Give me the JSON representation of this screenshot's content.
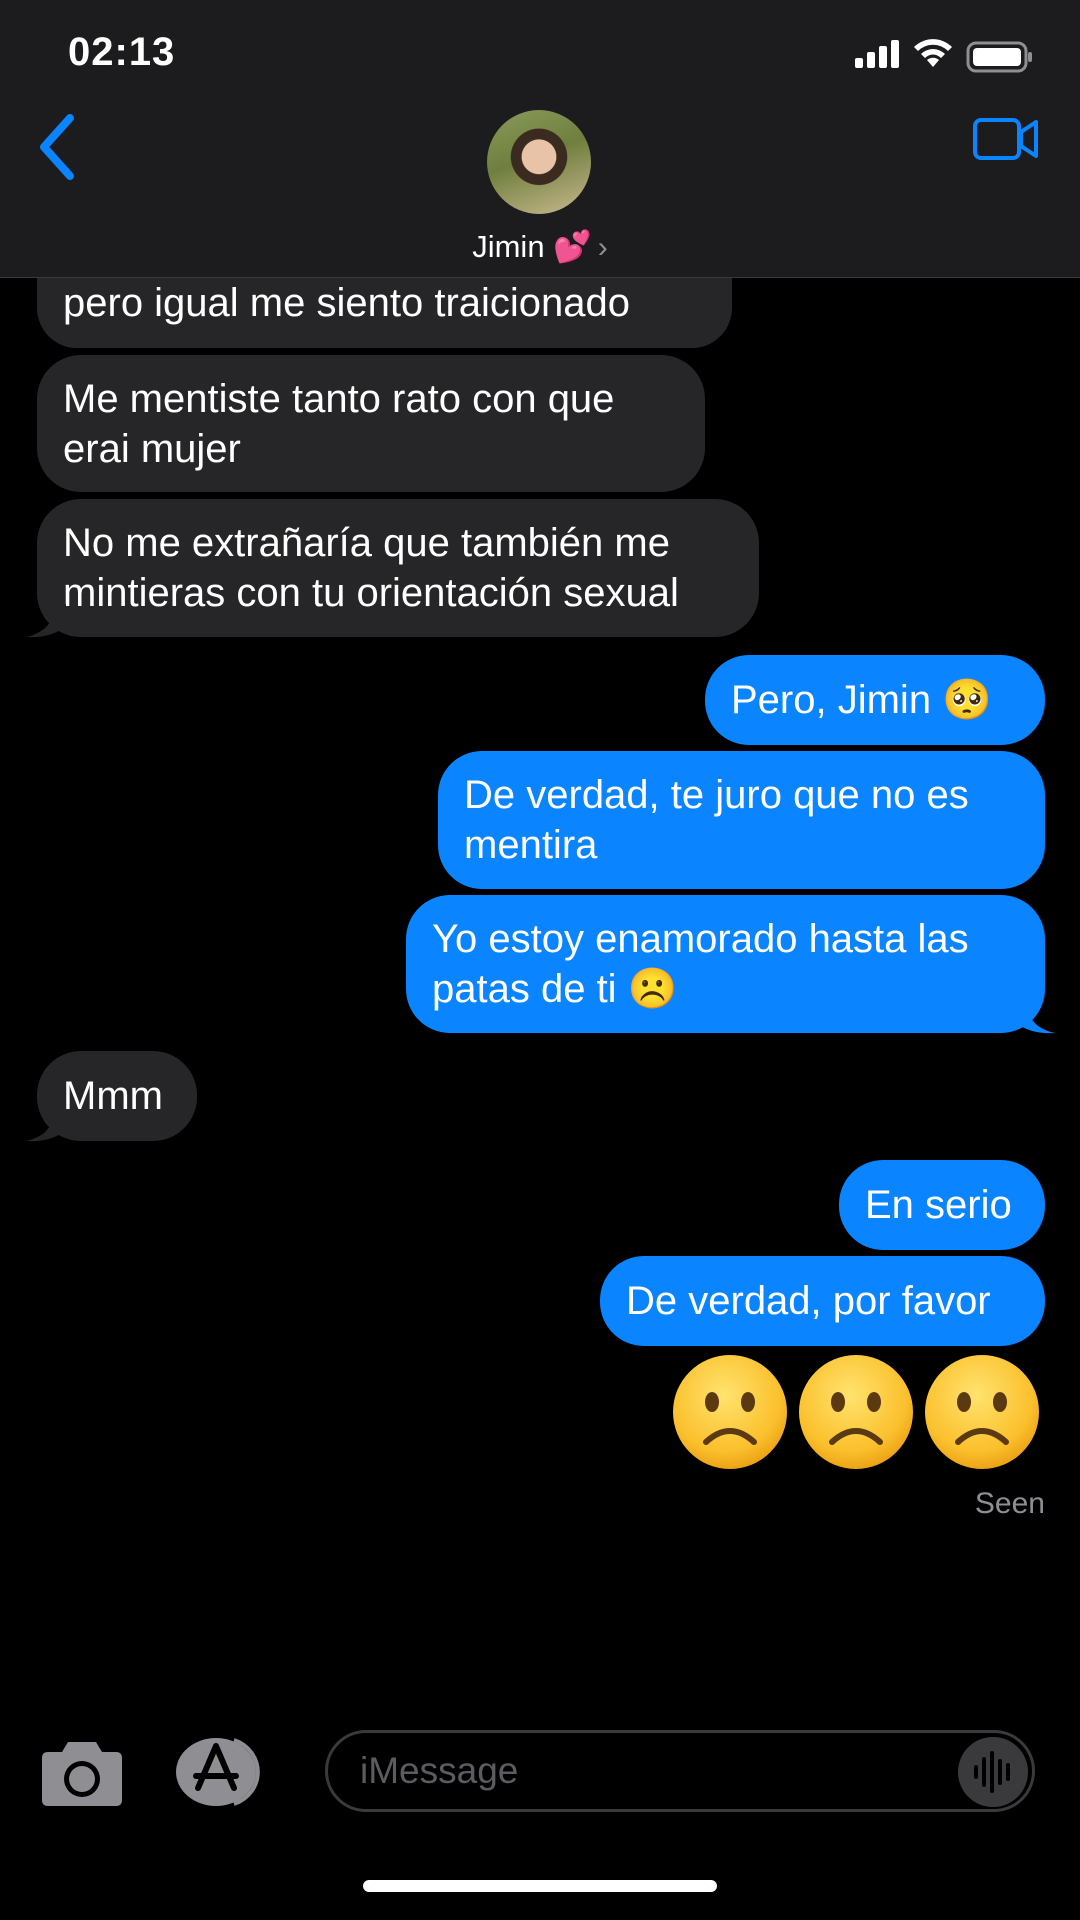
{
  "status_bar": {
    "time": "02:13"
  },
  "header": {
    "contact_name": "Jimin 💕",
    "chevron": "›"
  },
  "icons": {
    "back": "chevron-left-icon",
    "video": "video-camera-icon",
    "camera": "camera-icon",
    "appstore": "app-store-icon",
    "audio": "audio-waveform-icon"
  },
  "colors": {
    "accent": "#0a84ff",
    "received_bubble": "#262628",
    "header_bg": "#1c1c1e",
    "background": "#000000"
  },
  "messages": [
    {
      "direction": "received",
      "text": "pero igual me siento traicionado"
    },
    {
      "direction": "received",
      "text": "Me mentiste tanto rato con que erai mujer"
    },
    {
      "direction": "received",
      "text": "No me extrañaría que también me mintieras con tu orientación sexual"
    },
    {
      "direction": "sent",
      "text": "Pero, Jimin 🥺"
    },
    {
      "direction": "sent",
      "text": "De verdad, te juro que no es mentira"
    },
    {
      "direction": "sent",
      "text": "Yo estoy enamorado hasta las patas de ti ☹️"
    },
    {
      "direction": "received",
      "text": "Mmm"
    },
    {
      "direction": "sent",
      "text": "En serio"
    },
    {
      "direction": "sent",
      "text": "De verdad, por favor"
    },
    {
      "direction": "sent",
      "text": "☹️☹️☹️",
      "jumbo_emoji_count": 3
    }
  ],
  "read_receipt": "Seen",
  "input": {
    "placeholder": "iMessage",
    "value": ""
  }
}
